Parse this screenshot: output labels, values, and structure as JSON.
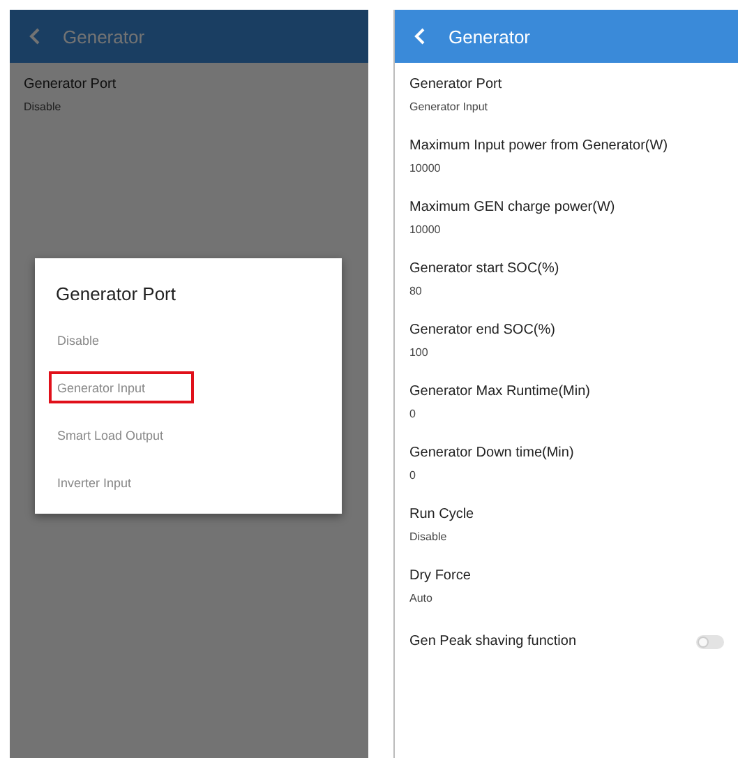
{
  "left_screen": {
    "header": {
      "title": "Generator"
    },
    "rows": [
      {
        "label": "Generator Port",
        "value": "Disable"
      }
    ],
    "dialog": {
      "title": "Generator Port",
      "options": [
        {
          "label": "Disable",
          "selected": false
        },
        {
          "label": "Generator Input",
          "selected": true
        },
        {
          "label": "Smart Load Output",
          "selected": false
        },
        {
          "label": "Inverter Input",
          "selected": false
        }
      ]
    }
  },
  "right_screen": {
    "header": {
      "title": "Generator"
    },
    "rows": [
      {
        "kind": "value",
        "label": "Generator Port",
        "value": "Generator Input"
      },
      {
        "kind": "value",
        "label": "Maximum Input power from Generator(W)",
        "value": "10000"
      },
      {
        "kind": "value",
        "label": "Maximum GEN charge power(W)",
        "value": "10000"
      },
      {
        "kind": "value",
        "label": "Generator start SOC(%)",
        "value": "80"
      },
      {
        "kind": "value",
        "label": "Generator end SOC(%)",
        "value": "100"
      },
      {
        "kind": "value",
        "label": "Generator Max Runtime(Min)",
        "value": "0"
      },
      {
        "kind": "value",
        "label": "Generator Down time(Min)",
        "value": "0"
      },
      {
        "kind": "value",
        "label": "Run Cycle",
        "value": "Disable"
      },
      {
        "kind": "value",
        "label": "Dry Force",
        "value": "Auto"
      },
      {
        "kind": "toggle",
        "label": "Gen Peak shaving function",
        "on": false
      }
    ]
  }
}
